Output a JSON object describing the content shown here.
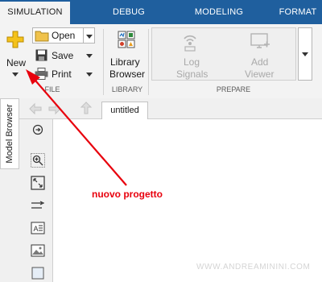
{
  "tabs": [
    {
      "label": "SIMULATION",
      "active": true
    },
    {
      "label": "DEBUG",
      "active": false
    },
    {
      "label": "MODELING",
      "active": false
    },
    {
      "label": "FORMAT",
      "active": false
    }
  ],
  "file_section": {
    "new_label": "New",
    "open_label": "Open",
    "save_label": "Save",
    "print_label": "Print",
    "section_label": "FILE"
  },
  "library_section": {
    "button_label_line1": "Library",
    "button_label_line2": "Browser",
    "section_label": "LIBRARY"
  },
  "prepare_section": {
    "log_line1": "Log",
    "log_line2": "Signals",
    "add_line1": "Add",
    "add_line2": "Viewer",
    "section_label": "PREPARE"
  },
  "model_browser_label": "Model Browser",
  "document_tab_label": "untitled",
  "annotation_text": "nuovo progetto",
  "watermark_text": "WWW.ANDREAMININI.COM",
  "colors": {
    "tabbar": "#1f5f9e",
    "annotation": "#e8000d"
  }
}
